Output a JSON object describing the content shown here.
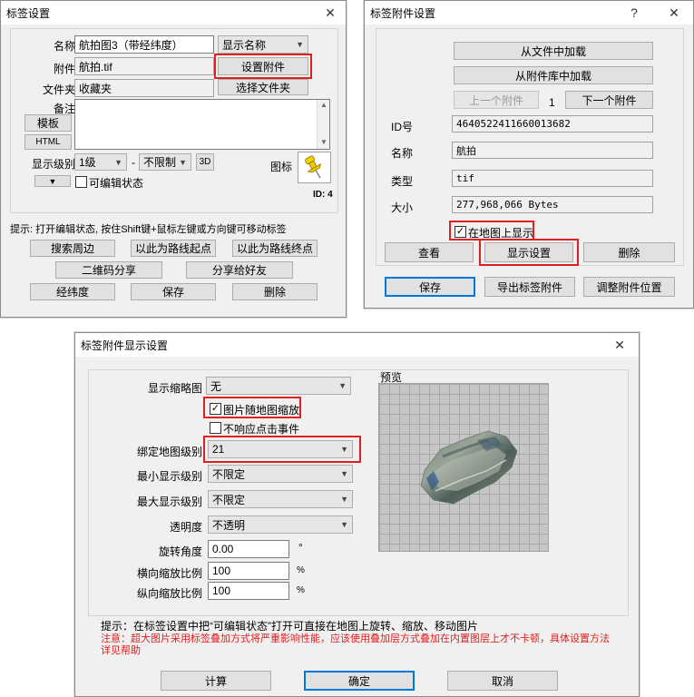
{
  "tag_settings": {
    "title": "标签设置",
    "name_label": "名称",
    "name_value": "航拍图3（带经纬度）",
    "display_name": "显示名称",
    "attach_label": "附件",
    "attach_value": "航拍.tif",
    "set_attach": "设置附件",
    "folder_label": "文件夹",
    "folder_value": "收藏夹",
    "select_folder": "选择文件夹",
    "note_label": "备注",
    "template": "模板",
    "html": "HTML",
    "level_label": "显示级别",
    "level_value": "1级",
    "dash": "-",
    "unlimited": "不限制",
    "btn_3d": "3D",
    "icon_label": "图标",
    "editable": "可编辑状态",
    "id_text": "ID: 4",
    "hint": "提示: 打开编辑状态, 按住Shift键+鼠标左键或方向键可移动标签",
    "search_around": "搜索周边",
    "route_start": "以此为路线起点",
    "route_end": "以此为路线终点",
    "qr_share": "二维码分享",
    "share_friend": "分享给好友",
    "latlon": "经纬度",
    "save": "保存",
    "delete": "删除"
  },
  "attachment_settings": {
    "title": "标签附件设置",
    "help": "?",
    "load_file": "从文件中加载",
    "load_library": "从附件库中加载",
    "prev": "上一个附件",
    "page": "1",
    "next": "下一个附件",
    "id_label": "ID号",
    "id_value": "4640522411660013682",
    "name_label": "名称",
    "name_value": "航拍",
    "type_label": "类型",
    "type_value": "tif",
    "size_label": "大小",
    "size_value": "277,968,066 Bytes",
    "show_on_map": "在地图上显示",
    "view": "查看",
    "display_settings": "显示设置",
    "delete": "删除",
    "save": "保存",
    "export": "导出标签附件",
    "adjust": "调整附件位置"
  },
  "display_settings": {
    "title": "标签附件显示设置",
    "thumb_label": "显示缩略图",
    "thumb_value": "无",
    "scale_with_map": "图片随地图缩放",
    "no_click": "不响应点击事件",
    "bind_level_label": "绑定地图级别",
    "bind_level_value": "21",
    "min_level_label": "最小显示级别",
    "min_level_value": "不限定",
    "max_level_label": "最大显示级别",
    "max_level_value": "不限定",
    "opacity_label": "透明度",
    "opacity_value": "不透明",
    "rotate_label": "旋转角度",
    "rotate_value": "0.00",
    "rotate_unit": "°",
    "hscale_label": "横向缩放比例",
    "hscale_value": "100",
    "hscale_unit": "%",
    "vscale_label": "纵向缩放比例",
    "vscale_value": "100",
    "vscale_unit": "%",
    "preview_label": "预览",
    "hint": "提示：在标签设置中把“可编辑状态”打开可直接在地图上旋转、缩放、移动图片",
    "warning_line1": "注意：超大图片采用标签叠加方式将严重影响性能，应该使用叠加层方式叠加在内置图层上才不卡顿，具体设置方法",
    "warning_line2": "详见帮助",
    "calc": "计算",
    "ok": "确定",
    "cancel": "取消"
  },
  "colors": {
    "highlight_red": "#e02020",
    "warning_text": "#e02020",
    "accent_blue": "#0078d7"
  }
}
